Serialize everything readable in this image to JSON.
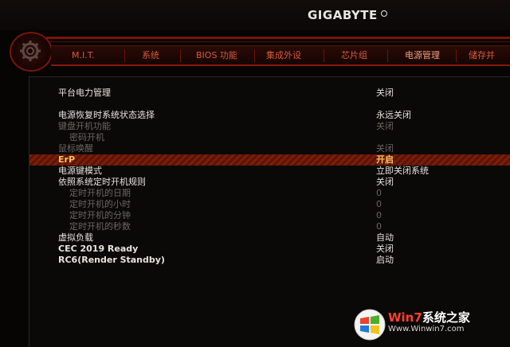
{
  "header": {
    "brand": "GIGABYTE"
  },
  "tabs": [
    {
      "label": "M.I.T.",
      "active": false
    },
    {
      "label": "系统",
      "active": false
    },
    {
      "label": "BIOS 功能",
      "active": false
    },
    {
      "label": "集成外设",
      "active": false
    },
    {
      "label": "芯片组",
      "active": false
    },
    {
      "label": "电源管理",
      "active": true
    },
    {
      "label": "储存并",
      "active": false
    }
  ],
  "rows": [
    {
      "label": "平台电力管理",
      "value": "关闭",
      "state": "bright"
    },
    {
      "label": "电源恢复时系统状态选择",
      "value": "永远关闭",
      "state": "bright"
    },
    {
      "label": "键盘开机功能",
      "value": "关闭",
      "state": "dim"
    },
    {
      "label": "密码开机",
      "value": "",
      "state": "dim"
    },
    {
      "label": "鼠标唤醒",
      "value": "关闭",
      "state": "dim"
    },
    {
      "label": "ErP",
      "value": "开启",
      "state": "selected"
    },
    {
      "label": "电源键模式",
      "value": "立即关闭系统",
      "state": "bright"
    },
    {
      "label": "依照系统定时开机规则",
      "value": "关闭",
      "state": "bright"
    },
    {
      "label": "定时开机的日期",
      "value": "0",
      "state": "dim"
    },
    {
      "label": "定时开机的小时",
      "value": "0",
      "state": "dim"
    },
    {
      "label": "定时开机的分钟",
      "value": "0",
      "state": "dim"
    },
    {
      "label": "定时开机的秒数",
      "value": "0",
      "state": "dim"
    },
    {
      "label": "虚拟负载",
      "value": "自动",
      "state": "bright"
    },
    {
      "label": "CEC 2019 Ready",
      "value": "关闭",
      "state": "bright"
    },
    {
      "label": "RC6(Render Standby)",
      "value": "启动",
      "state": "bright"
    }
  ],
  "watermark": {
    "title_a": "Win7",
    "title_b": "系统之家",
    "url": "Www.Winwin7.com"
  },
  "colors": {
    "accent": "#7a1408",
    "tab_text": "#d85a3c",
    "selected_text": "#f2c060"
  },
  "icons": {
    "settings": "gear-icon",
    "watermark": "windows-logo-icon"
  }
}
